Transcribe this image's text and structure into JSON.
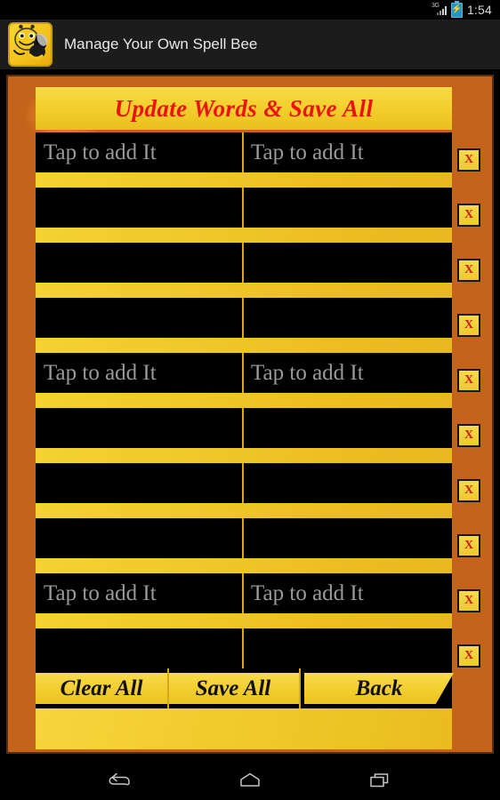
{
  "status_bar": {
    "network_label": "3G",
    "network_icon": "signal-3g-icon",
    "battery_icon": "battery-charging-icon",
    "battery_glyph": "⚡",
    "clock": "1:54"
  },
  "title_bar": {
    "app_icon": "bee-app-icon",
    "title": "Manage Your Own Spell Bee"
  },
  "main": {
    "banner_title": "Update Words & Save All",
    "placeholder": "Tap to add It",
    "delete_label": "X",
    "rows": [
      {
        "left": "Tap to add It",
        "right": "Tap to add It",
        "filled": false
      },
      {
        "left": "",
        "right": "",
        "filled": false
      },
      {
        "left": "",
        "right": "",
        "filled": false
      },
      {
        "left": "",
        "right": "",
        "filled": false
      },
      {
        "left": "Tap to add It",
        "right": "Tap to add It",
        "filled": false
      },
      {
        "left": "",
        "right": "",
        "filled": false
      },
      {
        "left": "",
        "right": "",
        "filled": false
      },
      {
        "left": "",
        "right": "",
        "filled": false
      },
      {
        "left": "Tap to add It",
        "right": "Tap to add It",
        "filled": false
      },
      {
        "left": "",
        "right": "",
        "filled": false
      }
    ]
  },
  "actions": {
    "clear_all": "Clear All",
    "save_all": "Save All",
    "back": "Back"
  },
  "nav_bar": {
    "back": "back-icon",
    "home": "home-icon",
    "recents": "recents-icon"
  },
  "colors": {
    "banner_yellow": "#f2ce2a",
    "title_red": "#ef1111",
    "field_black": "#000000",
    "placeholder_gray": "#9a9a9a",
    "divider_gold": "#d4a818",
    "x_red": "#c8201a",
    "background_amber": "#d8801f"
  }
}
